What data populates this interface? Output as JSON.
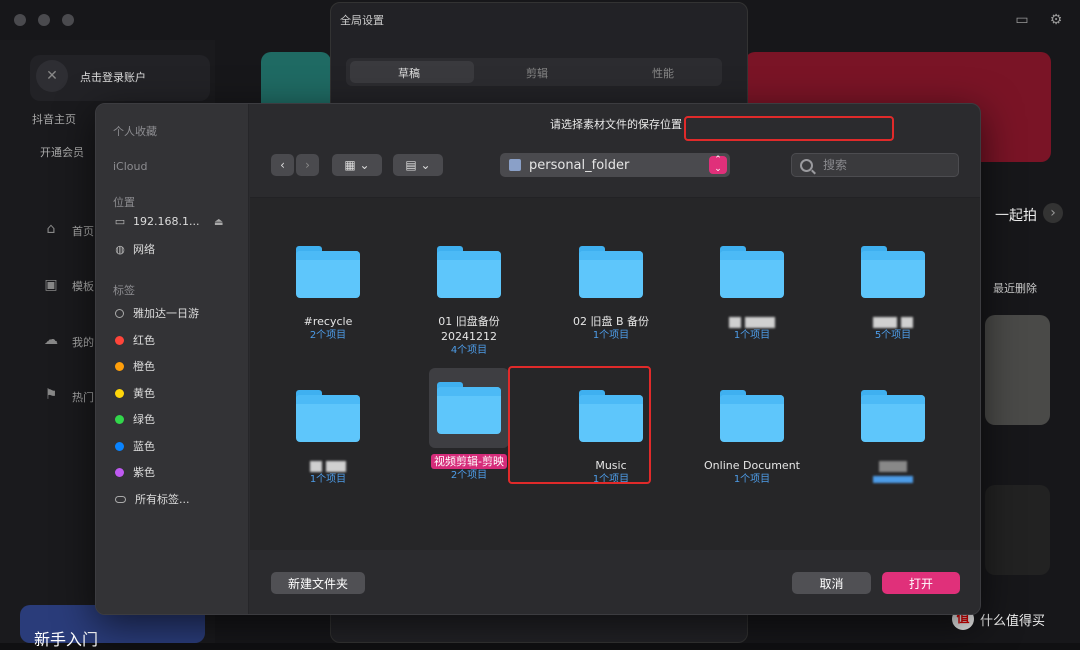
{
  "background_app": {
    "login_label": "点击登录账户",
    "douyin_label": "抖音主页",
    "member_label": "开通会员",
    "nav_labels": [
      "首页",
      "模板",
      "我的",
      "热门"
    ],
    "right_label": "一起拍",
    "recent_delete": "最近删除",
    "bottom_banner": "新手入门",
    "settings_title": "全局设置",
    "settings_tabs": [
      "草稿",
      "剪辑",
      "性能"
    ]
  },
  "dialog": {
    "prompt": "请选择素材文件的保存位置",
    "sidebar": {
      "favorites_header": "个人收藏",
      "icloud_header": "iCloud",
      "locations_header": "位置",
      "locations": [
        {
          "label": "192.168.1...",
          "icon": "monitor-icon"
        },
        {
          "label": "网络",
          "icon": "globe-icon"
        }
      ],
      "tags_header": "标签",
      "tags": [
        {
          "label": "雅加达一日游",
          "color": ""
        },
        {
          "label": "红色",
          "color": "#ff453a"
        },
        {
          "label": "橙色",
          "color": "#ff9f0a"
        },
        {
          "label": "黄色",
          "color": "#ffd60a"
        },
        {
          "label": "绿色",
          "color": "#32d74b"
        },
        {
          "label": "蓝色",
          "color": "#0a84ff"
        },
        {
          "label": "紫色",
          "color": "#bf5af2"
        },
        {
          "label": "所有标签...",
          "color": ""
        }
      ]
    },
    "path": "personal_folder",
    "search_placeholder": "搜索",
    "folders": [
      {
        "name": "#recycle",
        "count": "2个项目"
      },
      {
        "name": "01 旧盘备份\n20241212",
        "count": "4个项目"
      },
      {
        "name": "02 旧盘 B 备份",
        "count": "1个项目"
      },
      {
        "name": "",
        "count": "1个项目",
        "redacted": true
      },
      {
        "name": "",
        "count": "5个项目",
        "redacted": true
      },
      {
        "name": "",
        "count": "1个项目",
        "redacted": true
      },
      {
        "name": "视频剪辑-剪映",
        "count": "2个项目",
        "selected": true
      },
      {
        "name": "Music",
        "count": "1个项目"
      },
      {
        "name": "Online Document",
        "count": "1个项目"
      },
      {
        "name": "",
        "count": "",
        "redacted": true
      }
    ],
    "new_folder_label": "新建文件夹",
    "cancel_label": "取消",
    "open_label": "打开",
    "accent_color": "#e0307a",
    "annotation_color": "#e02a2a"
  },
  "watermark": "什么值得买"
}
